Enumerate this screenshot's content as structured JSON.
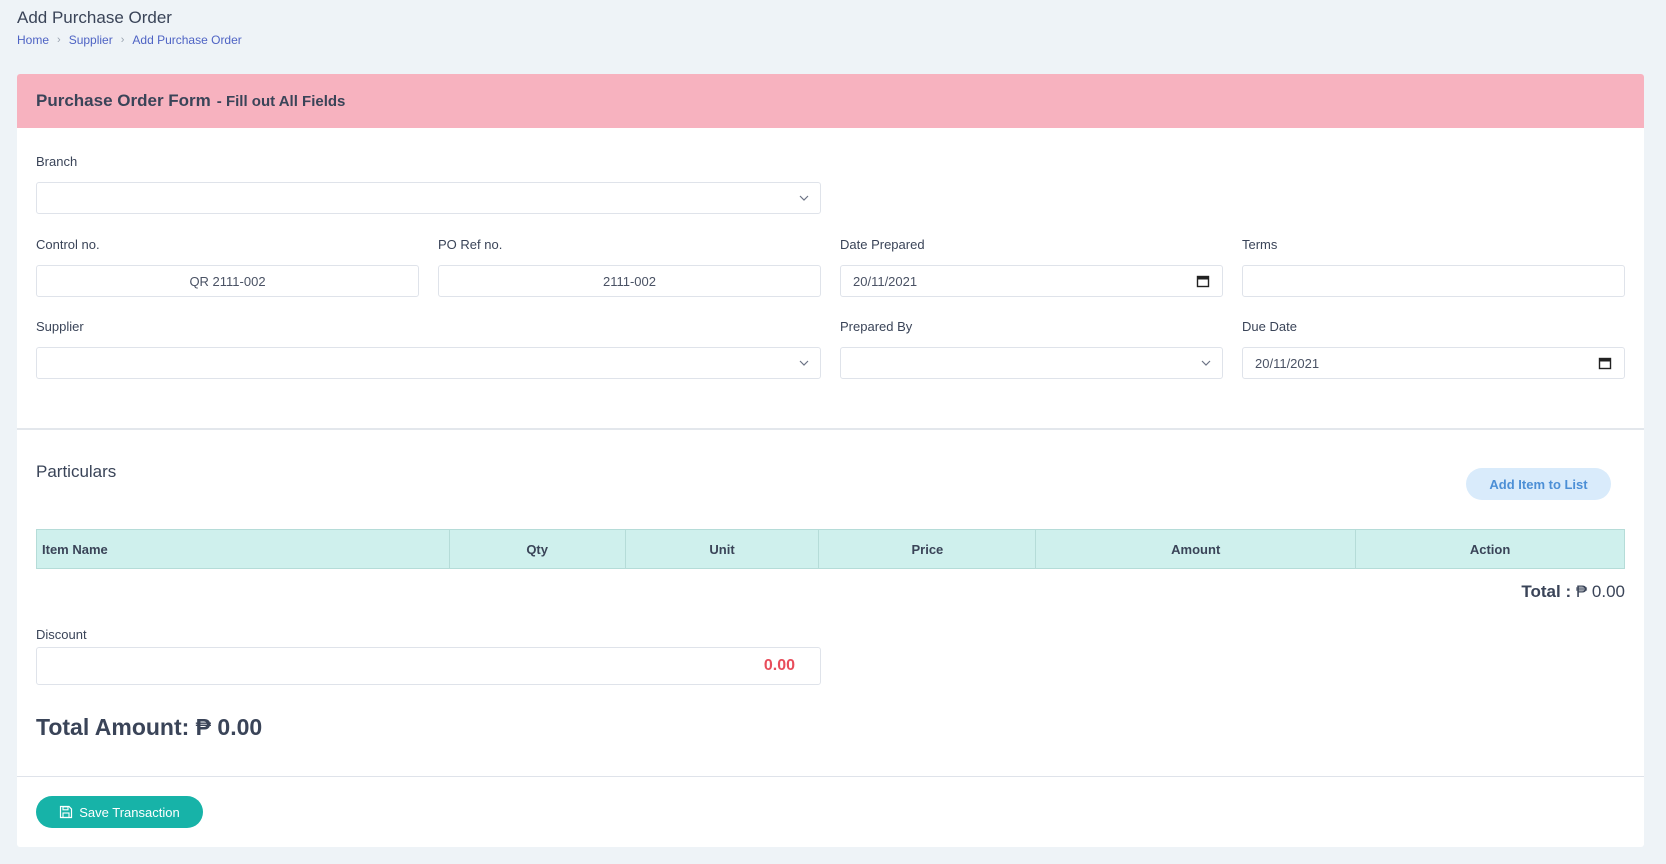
{
  "page": {
    "title": "Add Purchase Order",
    "breadcrumb": [
      "Home",
      "Supplier",
      "Add Purchase Order"
    ]
  },
  "form": {
    "header_title": "Purchase Order Form",
    "header_subtitle": "- Fill out All Fields",
    "branch": {
      "label": "Branch",
      "value": ""
    },
    "control_no": {
      "label": "Control no.",
      "value": "QR 2111-002"
    },
    "po_ref_no": {
      "label": "PO Ref no.",
      "value": "2111-002"
    },
    "date_prepared": {
      "label": "Date Prepared",
      "value": "20/11/2021"
    },
    "terms": {
      "label": "Terms",
      "value": ""
    },
    "supplier": {
      "label": "Supplier",
      "value": ""
    },
    "prepared_by": {
      "label": "Prepared By",
      "value": ""
    },
    "due_date": {
      "label": "Due Date",
      "value": "20/11/2021"
    }
  },
  "particulars": {
    "title": "Particulars",
    "add_button": "Add Item to List",
    "columns": [
      "Item Name",
      "Qty",
      "Unit",
      "Price",
      "Amount",
      "Action"
    ],
    "total_label": "Total :",
    "total_value": "₱ 0.00"
  },
  "discount": {
    "label": "Discount",
    "value": "0.00"
  },
  "total_amount": "Total Amount: ₱ 0.00",
  "save_button": "Save Transaction",
  "colors": {
    "header_bg": "#f7b2bf",
    "table_header_bg": "#cff0ed",
    "save_button": "#17b3a8",
    "add_button_bg": "#d9ebfb",
    "discount_value": "#e84d5b"
  }
}
